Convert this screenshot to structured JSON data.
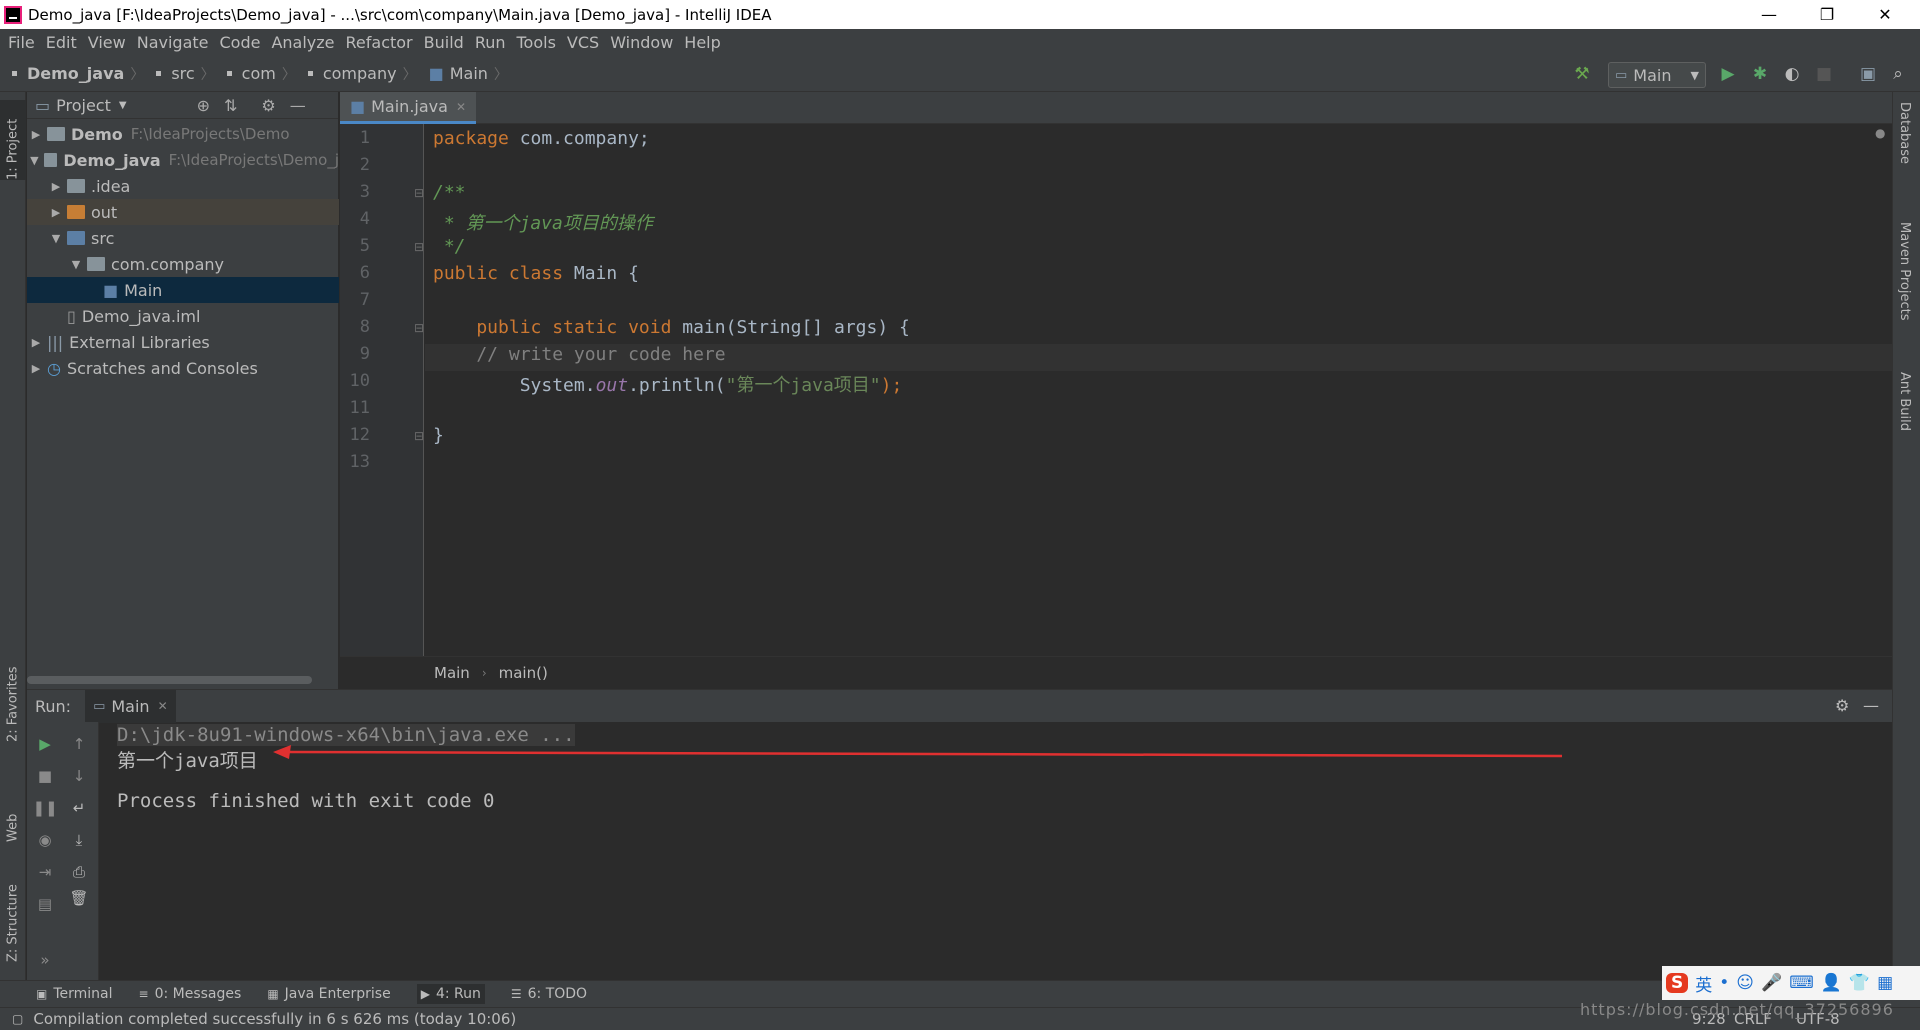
{
  "window": {
    "title": "Demo_java [F:\\IdeaProjects\\Demo_java] - ...\\src\\com\\company\\Main.java [Demo_java] - IntelliJ IDEA"
  },
  "menu": [
    "File",
    "Edit",
    "View",
    "Navigate",
    "Code",
    "Analyze",
    "Refactor",
    "Build",
    "Run",
    "Tools",
    "VCS",
    "Window",
    "Help"
  ],
  "breadcrumbs": [
    "Demo_java",
    "src",
    "com",
    "company",
    "Main"
  ],
  "run_config": "Main",
  "left_tabs": {
    "project": "1: Project",
    "favorites": "2: Favorites",
    "web": "Web",
    "structure": "Z: Structure"
  },
  "right_tabs": {
    "database": "Database",
    "maven": "Maven Projects",
    "ant": "Ant Build"
  },
  "project": {
    "header": "Project",
    "tree": [
      {
        "label": "Demo",
        "path": "F:\\IdeaProjects\\Demo"
      },
      {
        "label": "Demo_java",
        "path": "F:\\IdeaProjects\\Demo_j"
      },
      {
        "label": ".idea"
      },
      {
        "label": "out"
      },
      {
        "label": "src"
      },
      {
        "label": "com.company"
      },
      {
        "label": "Main"
      },
      {
        "label": "Demo_java.iml"
      },
      {
        "label": "External Libraries"
      },
      {
        "label": "Scratches and Consoles"
      }
    ]
  },
  "editor": {
    "tab": "Main.java",
    "line_numbers": [
      "1",
      "2",
      "3",
      "4",
      "5",
      "6",
      "7",
      "8",
      "9",
      "10",
      "11",
      "12",
      "13"
    ],
    "lines": {
      "l1_kw": "package",
      "l1_rest": " com.company;",
      "l3": "/**",
      "l4": " * 第一个java项目的操作",
      "l5": " */",
      "l6_kw": "public class",
      "l6_rest": " Main {",
      "l8_kw": "    public static void",
      "l8_rest": " main(String[] args) {",
      "l9": "    // write your code here",
      "l10_a": "        System.",
      "l10_b": "out",
      "l10_c": ".println(",
      "l10_str": "\"第一个java项目\"",
      "l10_d": ");",
      "l12": "}"
    },
    "breadcrumb": [
      "Main",
      "main()"
    ]
  },
  "run": {
    "label": "Run:",
    "tab": "Main",
    "console": [
      "D:\\jdk-8u91-windows-x64\\bin\\java.exe ...",
      "第一个java项目",
      "",
      "Process finished with exit code 0"
    ]
  },
  "bottom_tabs": [
    "Terminal",
    "0: Messages",
    "Java Enterprise",
    "4: Run",
    "6: TODO"
  ],
  "status": {
    "message": "Compilation completed successfully in 6 s 626 ms (today 10:06)",
    "position": "9:28",
    "line_sep": "CRLF",
    "encoding": "UTF-8"
  },
  "ime": [
    "S",
    "英",
    "•",
    "☺",
    "🎤",
    "⌨",
    "👤",
    "👕",
    "▦"
  ],
  "watermark": "https://blog.csdn.net/qq_37256896",
  "colors": {
    "accent": "#4a88c7",
    "arrow": "#e03030",
    "keyword": "#cc7832",
    "string": "#6a8759",
    "doc": "#629755"
  }
}
